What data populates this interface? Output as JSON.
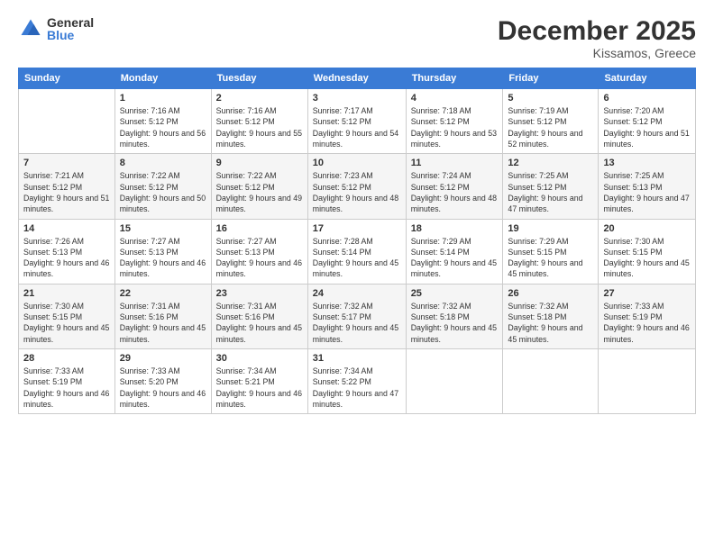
{
  "logo": {
    "general": "General",
    "blue": "Blue"
  },
  "header": {
    "month": "December 2025",
    "location": "Kissamos, Greece"
  },
  "weekdays": [
    "Sunday",
    "Monday",
    "Tuesday",
    "Wednesday",
    "Thursday",
    "Friday",
    "Saturday"
  ],
  "weeks": [
    [
      {
        "day": "",
        "sunrise": "",
        "sunset": "",
        "daylight": ""
      },
      {
        "day": "1",
        "sunrise": "Sunrise: 7:16 AM",
        "sunset": "Sunset: 5:12 PM",
        "daylight": "Daylight: 9 hours and 56 minutes."
      },
      {
        "day": "2",
        "sunrise": "Sunrise: 7:16 AM",
        "sunset": "Sunset: 5:12 PM",
        "daylight": "Daylight: 9 hours and 55 minutes."
      },
      {
        "day": "3",
        "sunrise": "Sunrise: 7:17 AM",
        "sunset": "Sunset: 5:12 PM",
        "daylight": "Daylight: 9 hours and 54 minutes."
      },
      {
        "day": "4",
        "sunrise": "Sunrise: 7:18 AM",
        "sunset": "Sunset: 5:12 PM",
        "daylight": "Daylight: 9 hours and 53 minutes."
      },
      {
        "day": "5",
        "sunrise": "Sunrise: 7:19 AM",
        "sunset": "Sunset: 5:12 PM",
        "daylight": "Daylight: 9 hours and 52 minutes."
      },
      {
        "day": "6",
        "sunrise": "Sunrise: 7:20 AM",
        "sunset": "Sunset: 5:12 PM",
        "daylight": "Daylight: 9 hours and 51 minutes."
      }
    ],
    [
      {
        "day": "7",
        "sunrise": "Sunrise: 7:21 AM",
        "sunset": "Sunset: 5:12 PM",
        "daylight": "Daylight: 9 hours and 51 minutes."
      },
      {
        "day": "8",
        "sunrise": "Sunrise: 7:22 AM",
        "sunset": "Sunset: 5:12 PM",
        "daylight": "Daylight: 9 hours and 50 minutes."
      },
      {
        "day": "9",
        "sunrise": "Sunrise: 7:22 AM",
        "sunset": "Sunset: 5:12 PM",
        "daylight": "Daylight: 9 hours and 49 minutes."
      },
      {
        "day": "10",
        "sunrise": "Sunrise: 7:23 AM",
        "sunset": "Sunset: 5:12 PM",
        "daylight": "Daylight: 9 hours and 48 minutes."
      },
      {
        "day": "11",
        "sunrise": "Sunrise: 7:24 AM",
        "sunset": "Sunset: 5:12 PM",
        "daylight": "Daylight: 9 hours and 48 minutes."
      },
      {
        "day": "12",
        "sunrise": "Sunrise: 7:25 AM",
        "sunset": "Sunset: 5:12 PM",
        "daylight": "Daylight: 9 hours and 47 minutes."
      },
      {
        "day": "13",
        "sunrise": "Sunrise: 7:25 AM",
        "sunset": "Sunset: 5:13 PM",
        "daylight": "Daylight: 9 hours and 47 minutes."
      }
    ],
    [
      {
        "day": "14",
        "sunrise": "Sunrise: 7:26 AM",
        "sunset": "Sunset: 5:13 PM",
        "daylight": "Daylight: 9 hours and 46 minutes."
      },
      {
        "day": "15",
        "sunrise": "Sunrise: 7:27 AM",
        "sunset": "Sunset: 5:13 PM",
        "daylight": "Daylight: 9 hours and 46 minutes."
      },
      {
        "day": "16",
        "sunrise": "Sunrise: 7:27 AM",
        "sunset": "Sunset: 5:13 PM",
        "daylight": "Daylight: 9 hours and 46 minutes."
      },
      {
        "day": "17",
        "sunrise": "Sunrise: 7:28 AM",
        "sunset": "Sunset: 5:14 PM",
        "daylight": "Daylight: 9 hours and 45 minutes."
      },
      {
        "day": "18",
        "sunrise": "Sunrise: 7:29 AM",
        "sunset": "Sunset: 5:14 PM",
        "daylight": "Daylight: 9 hours and 45 minutes."
      },
      {
        "day": "19",
        "sunrise": "Sunrise: 7:29 AM",
        "sunset": "Sunset: 5:15 PM",
        "daylight": "Daylight: 9 hours and 45 minutes."
      },
      {
        "day": "20",
        "sunrise": "Sunrise: 7:30 AM",
        "sunset": "Sunset: 5:15 PM",
        "daylight": "Daylight: 9 hours and 45 minutes."
      }
    ],
    [
      {
        "day": "21",
        "sunrise": "Sunrise: 7:30 AM",
        "sunset": "Sunset: 5:15 PM",
        "daylight": "Daylight: 9 hours and 45 minutes."
      },
      {
        "day": "22",
        "sunrise": "Sunrise: 7:31 AM",
        "sunset": "Sunset: 5:16 PM",
        "daylight": "Daylight: 9 hours and 45 minutes."
      },
      {
        "day": "23",
        "sunrise": "Sunrise: 7:31 AM",
        "sunset": "Sunset: 5:16 PM",
        "daylight": "Daylight: 9 hours and 45 minutes."
      },
      {
        "day": "24",
        "sunrise": "Sunrise: 7:32 AM",
        "sunset": "Sunset: 5:17 PM",
        "daylight": "Daylight: 9 hours and 45 minutes."
      },
      {
        "day": "25",
        "sunrise": "Sunrise: 7:32 AM",
        "sunset": "Sunset: 5:18 PM",
        "daylight": "Daylight: 9 hours and 45 minutes."
      },
      {
        "day": "26",
        "sunrise": "Sunrise: 7:32 AM",
        "sunset": "Sunset: 5:18 PM",
        "daylight": "Daylight: 9 hours and 45 minutes."
      },
      {
        "day": "27",
        "sunrise": "Sunrise: 7:33 AM",
        "sunset": "Sunset: 5:19 PM",
        "daylight": "Daylight: 9 hours and 46 minutes."
      }
    ],
    [
      {
        "day": "28",
        "sunrise": "Sunrise: 7:33 AM",
        "sunset": "Sunset: 5:19 PM",
        "daylight": "Daylight: 9 hours and 46 minutes."
      },
      {
        "day": "29",
        "sunrise": "Sunrise: 7:33 AM",
        "sunset": "Sunset: 5:20 PM",
        "daylight": "Daylight: 9 hours and 46 minutes."
      },
      {
        "day": "30",
        "sunrise": "Sunrise: 7:34 AM",
        "sunset": "Sunset: 5:21 PM",
        "daylight": "Daylight: 9 hours and 46 minutes."
      },
      {
        "day": "31",
        "sunrise": "Sunrise: 7:34 AM",
        "sunset": "Sunset: 5:22 PM",
        "daylight": "Daylight: 9 hours and 47 minutes."
      },
      {
        "day": "",
        "sunrise": "",
        "sunset": "",
        "daylight": ""
      },
      {
        "day": "",
        "sunrise": "",
        "sunset": "",
        "daylight": ""
      },
      {
        "day": "",
        "sunrise": "",
        "sunset": "",
        "daylight": ""
      }
    ]
  ]
}
